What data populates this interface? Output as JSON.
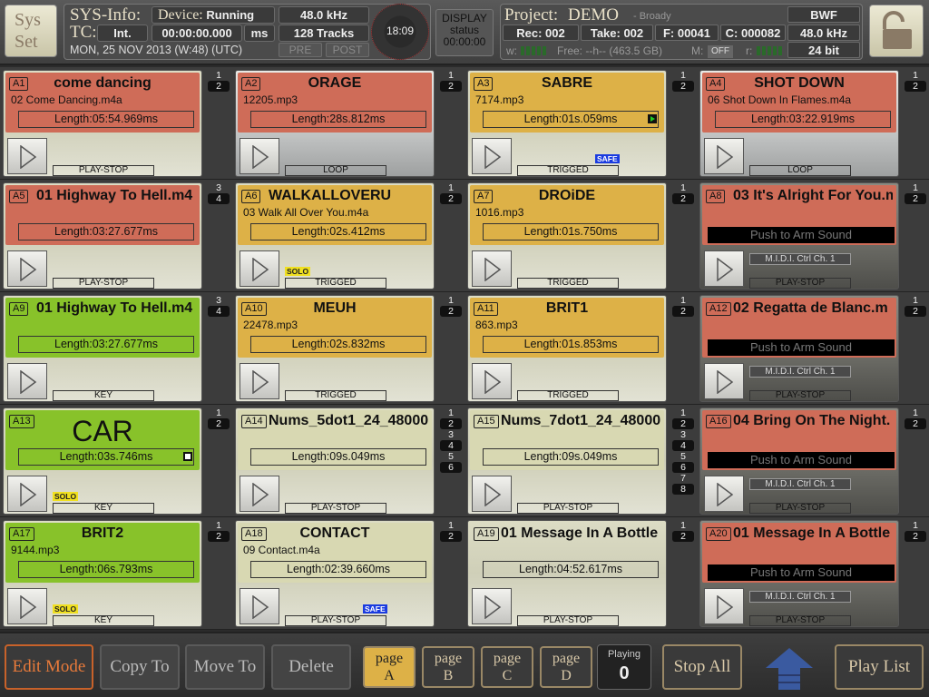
{
  "top": {
    "sysset": [
      "Sys",
      "Set"
    ],
    "sysinfo_label": "SYS-Info:",
    "device_label": "Device:",
    "device_value": "Running",
    "rate": "48.0 kHz",
    "tc_label": "TC:",
    "tc_source": "Int.",
    "tc_value": "00:00:00.000",
    "tc_unit": "ms",
    "tracks": "128 Tracks",
    "pre": "PRE",
    "post": "POST",
    "date": "MON, 25 NOV 2013 (W:48) (UTC)",
    "clock": "18:09",
    "display": [
      "DISPLAY",
      "status",
      "00:00:00"
    ],
    "project_label": "Project:",
    "project_name": "DEMO",
    "project_author": "- Broady",
    "format": "BWF",
    "rec": "Rec: 002",
    "take": "Take: 002",
    "f": "F: 00041",
    "c": "C: 000082",
    "proj_rate": "48.0 kHz",
    "bits": "24 bit",
    "w_label": "w:",
    "free": "Free: --h-- (463.5 GB)",
    "m_label": "M:",
    "m_value": "OFF",
    "r_label": "r:"
  },
  "pads": [
    {
      "id": "A1",
      "title": "come dancing",
      "file": "02 Come Dancing.m4a",
      "length": "Length:05:54.969ms",
      "mode": "PLAY-STOP",
      "color": "red",
      "body": "cream",
      "outs": [
        "1",
        "2"
      ]
    },
    {
      "id": "A2",
      "title": "ORAGE",
      "file": "12205.mp3",
      "length": "Length:28s.812ms",
      "mode": "LOOP",
      "color": "red",
      "body": "silver",
      "outs": [
        "1",
        "2"
      ]
    },
    {
      "id": "A3",
      "title": "SABRE",
      "file": "7174.mp3",
      "length": "Length:01s.059ms",
      "mode": "TRIGGED",
      "color": "orange",
      "body": "cream",
      "safe": "SAFE",
      "indicator": "play",
      "outs": [
        "1",
        "2"
      ]
    },
    {
      "id": "A4",
      "title": "SHOT DOWN",
      "file": "06 Shot Down In Flames.m4a",
      "length": "Length:03:22.919ms",
      "mode": "LOOP",
      "color": "red",
      "body": "silver",
      "outs": [
        "1",
        "2"
      ]
    },
    {
      "id": "A5",
      "title": "01 Highway To Hell.m4",
      "length": "Length:03:27.677ms",
      "mode": "PLAY-STOP",
      "color": "red",
      "body": "cream",
      "align": "left",
      "outs": [
        "3",
        "4"
      ]
    },
    {
      "id": "A6",
      "title": "WALKALLOVERU",
      "file": "03 Walk All Over You.m4a",
      "length": "Length:02s.412ms",
      "mode": "TRIGGED",
      "color": "orange",
      "body": "cream",
      "align": "left",
      "solo": "SOLO",
      "outs": [
        "1",
        "2"
      ]
    },
    {
      "id": "A7",
      "title": "DROiDE",
      "file": "1016.mp3",
      "length": "Length:01s.750ms",
      "mode": "TRIGGED",
      "color": "orange",
      "body": "cream",
      "outs": [
        "1",
        "2"
      ]
    },
    {
      "id": "A8",
      "title": "03 It's Alright For You.m",
      "push": "Push to Arm Sound",
      "midi": "M.I.D.I. Ctrl Ch. 1",
      "mode": "PLAY-STOP",
      "color": "red",
      "body": "graygrad",
      "align": "left",
      "outs": [
        "1",
        "2"
      ]
    },
    {
      "id": "A9",
      "title": "01 Highway To Hell.m4",
      "length": "Length:03:27.677ms",
      "mode": "KEY",
      "color": "green",
      "body": "cream",
      "align": "left",
      "outs": [
        "3",
        "4"
      ]
    },
    {
      "id": "A10",
      "title": "MEUH",
      "file": "22478.mp3",
      "length": "Length:02s.832ms",
      "mode": "TRIGGED",
      "color": "orange",
      "body": "cream",
      "outs": [
        "1",
        "2"
      ]
    },
    {
      "id": "A11",
      "title": "BRIT1",
      "file": "863.mp3",
      "length": "Length:01s.853ms",
      "mode": "TRIGGED",
      "color": "orange",
      "body": "cream",
      "outs": [
        "1",
        "2"
      ]
    },
    {
      "id": "A12",
      "title": "02 Regatta de Blanc.m",
      "push": "Push to Arm Sound",
      "midi": "M.I.D.I. Ctrl Ch. 1",
      "mode": "PLAY-STOP",
      "color": "red",
      "body": "graygrad",
      "align": "left",
      "outs": [
        "1",
        "2"
      ]
    },
    {
      "id": "A13",
      "title": "CAR",
      "length": "Length:03s.746ms",
      "mode": "KEY",
      "color": "green",
      "body": "cream",
      "big": true,
      "solo": "SOLO",
      "indicator": "stop",
      "outs": [
        "1",
        "2"
      ]
    },
    {
      "id": "A14",
      "title": "Nums_5dot1_24_48000",
      "length": "Length:09s.049ms",
      "mode": "PLAY-STOP",
      "color": "cream",
      "body": "cream",
      "align": "left",
      "outs": [
        "1",
        "2",
        "3",
        "4",
        "5",
        "6"
      ]
    },
    {
      "id": "A15",
      "title": "Nums_7dot1_24_48000",
      "length": "Length:09s.049ms",
      "mode": "PLAY-STOP",
      "color": "cream",
      "body": "cream",
      "align": "left",
      "outs": [
        "1",
        "2",
        "3",
        "4",
        "5",
        "6",
        "7",
        "8"
      ]
    },
    {
      "id": "A16",
      "title": "04 Bring On The Night.",
      "push": "Push to Arm Sound",
      "midi": "M.I.D.I. Ctrl Ch. 1",
      "mode": "PLAY-STOP",
      "color": "red",
      "body": "graygrad",
      "align": "left",
      "outs": [
        "1",
        "2"
      ]
    },
    {
      "id": "A17",
      "title": "BRIT2",
      "file": "9144.mp3",
      "length": "Length:06s.793ms",
      "mode": "KEY",
      "color": "green",
      "body": "cream",
      "solo": "SOLO",
      "outs": [
        "1",
        "2"
      ]
    },
    {
      "id": "A18",
      "title": "CONTACT",
      "file": "09 Contact.m4a",
      "length": "Length:02:39.660ms",
      "mode": "PLAY-STOP",
      "color": "cream",
      "body": "cream",
      "safe": "SAFE",
      "outs": [
        "1",
        "2"
      ]
    },
    {
      "id": "A19",
      "title": "01 Message In A Bottle",
      "length": "Length:04:52.617ms",
      "mode": "PLAY-STOP",
      "color": "none",
      "body": "cream",
      "align": "left",
      "outs": [
        "1",
        "2"
      ]
    },
    {
      "id": "A20",
      "title": "01 Message In A Bottle",
      "push": "Push to Arm Sound",
      "midi": "M.I.D.I. Ctrl Ch. 1",
      "mode": "PLAY-STOP",
      "color": "red",
      "body": "graygrad",
      "align": "left",
      "outs": [
        "1",
        "2"
      ]
    }
  ],
  "bottom": {
    "edit_mode": "Edit Mode",
    "copy_to": "Copy To",
    "move_to": "Move To",
    "delete": "Delete",
    "pages": [
      {
        "word": "page",
        "letter": "A"
      },
      {
        "word": "page",
        "letter": "B"
      },
      {
        "word": "page",
        "letter": "C"
      },
      {
        "word": "page",
        "letter": "D"
      }
    ],
    "playing_label": "Playing",
    "playing_value": "0",
    "stop_all": "Stop All",
    "play_list": "Play List"
  }
}
